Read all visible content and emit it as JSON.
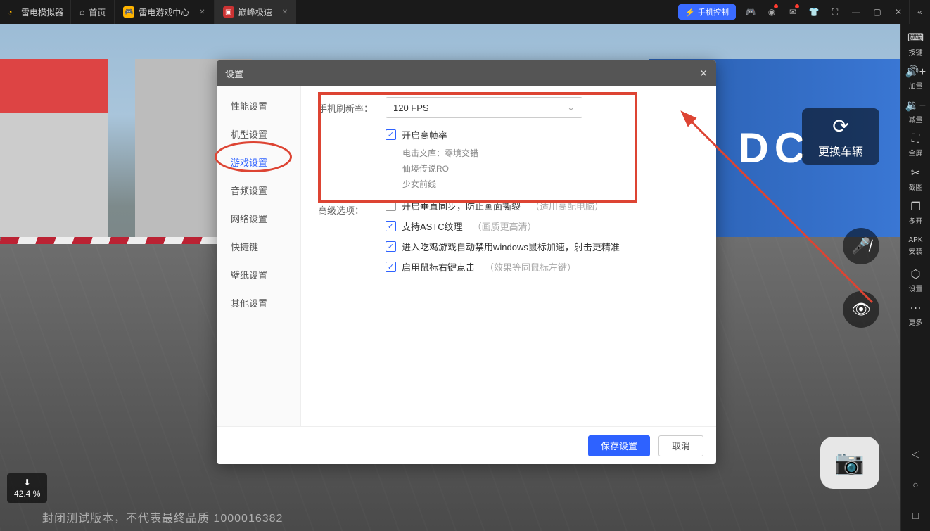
{
  "titlebar": {
    "app_name": "雷电模拟器",
    "tabs": [
      {
        "label": "首页",
        "icon": "home"
      },
      {
        "label": "雷电游戏中心",
        "icon": "gamepad"
      },
      {
        "label": "巅峰极速",
        "icon": "game",
        "active": true
      }
    ],
    "phone_control": "手机控制",
    "win_buttons": [
      "min",
      "max",
      "close",
      "collapse"
    ]
  },
  "siderail": {
    "items": [
      {
        "icon": "⌨",
        "label": "按键"
      },
      {
        "icon": "🔊+",
        "label": "加量"
      },
      {
        "icon": "🔉−",
        "label": "减量"
      },
      {
        "icon": "⛶",
        "label": "全屏"
      },
      {
        "icon": "✂",
        "label": "截图"
      },
      {
        "icon": "❐",
        "label": "多开"
      },
      {
        "icon": "APK",
        "label": "安装"
      },
      {
        "icon": "⬡",
        "label": "设置"
      },
      {
        "icon": "⋯",
        "label": "更多"
      }
    ],
    "nav": [
      "◁",
      "○",
      "□"
    ]
  },
  "hud": {
    "swap_label": "更换车辆",
    "download_pct": "42.4 %",
    "watermark": "封闭测试版本，不代表最终品质 1000016382",
    "bg_text": "DC"
  },
  "modal": {
    "title": "设置",
    "nav": [
      "性能设置",
      "机型设置",
      "游戏设置",
      "音频设置",
      "网络设置",
      "快捷键",
      "壁纸设置",
      "其他设置"
    ],
    "active_nav_index": 2,
    "fields": {
      "refresh_label": "手机刷新率：",
      "refresh_value": "120 FPS",
      "high_fps_checkbox": "开启高帧率",
      "high_fps_sub": [
        "电击文库：零境交错",
        "仙境传说RO",
        "少女前线"
      ],
      "adv_label": "高级选项：",
      "vsync": {
        "label": "开启垂直同步，防止画面撕裂",
        "hint": "（适用高配电脑）",
        "checked": false
      },
      "astc": {
        "label": "支持ASTC纹理",
        "hint": "（画质更高清）",
        "checked": true
      },
      "mouse": {
        "label": "进入吃鸡游戏自动禁用windows鼠标加速，射击更精准",
        "checked": true
      },
      "rclick": {
        "label": "启用鼠标右键点击",
        "hint": "（效果等同鼠标左键）",
        "checked": true
      }
    },
    "buttons": {
      "save": "保存设置",
      "cancel": "取消"
    }
  }
}
